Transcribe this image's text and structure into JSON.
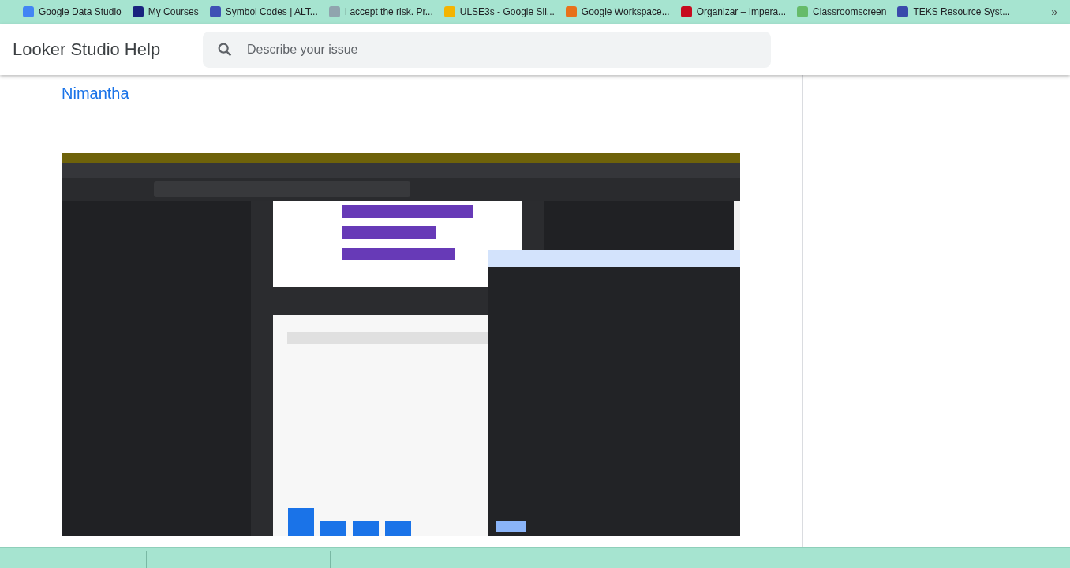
{
  "bookmarks": [
    {
      "label": "Google Data Studio",
      "color": "#4285f4"
    },
    {
      "label": "My Courses",
      "color": "#1a237e"
    },
    {
      "label": "Symbol Codes | ALT...",
      "color": "#3f51b5"
    },
    {
      "label": "I accept the risk. Pr...",
      "color": "#90a4ae"
    },
    {
      "label": "ULSE3s - Google Sli...",
      "color": "#f4b400"
    },
    {
      "label": "Google Workspace...",
      "color": "#e8711a"
    },
    {
      "label": "Organizar – Impera...",
      "color": "#c60b1e"
    },
    {
      "label": "Classroomscreen",
      "color": "#66bb6a"
    },
    {
      "label": "TEKS Resource Syst...",
      "color": "#3949ab"
    }
  ],
  "bookmarks_overflow": "»",
  "header": {
    "title": "Looker Studio Help",
    "search": {
      "placeholder": "Describe your issue"
    }
  },
  "post": {
    "author_link": "Nimantha"
  }
}
